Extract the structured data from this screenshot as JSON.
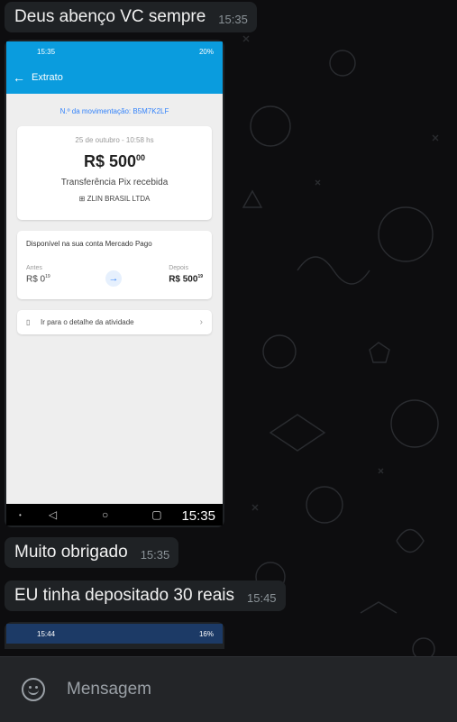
{
  "messages": [
    {
      "text": "Deus abenço VC sempre",
      "time": "15:35"
    },
    {
      "text": "Muito obrigado",
      "time": "15:35"
    },
    {
      "text": "EU tinha depositado 30 reais",
      "time": "15:45"
    }
  ],
  "screenshot1": {
    "status_time": "15:35",
    "status_right": "20%",
    "header_title": "Extrato",
    "movement_id": "N.º da movimentação: B5M7K2LF",
    "date": "25 de outubro - 10:58 hs",
    "amount_main": "R$ 500",
    "amount_cents": "00",
    "description": "Transferência Pix recebida",
    "payer": "ZLIN BRASIL LTDA",
    "available_title": "Disponível na sua conta Mercado Pago",
    "before_label": "Antes",
    "before_main": "R$ 0",
    "before_cents": "19",
    "after_label": "Depois",
    "after_main": "R$ 500",
    "after_cents": "19",
    "detail_link": "Ir para o detalhe da atividade",
    "image_time": "15:35"
  },
  "screenshot2": {
    "status_time": "15:44",
    "status_right": "16%"
  },
  "composer": {
    "placeholder": "Mensagem"
  },
  "colors": {
    "bubble": "#1f2225",
    "app_blue": "#0a9cde",
    "link_blue": "#3483fa",
    "background": "#0d0d0f"
  }
}
